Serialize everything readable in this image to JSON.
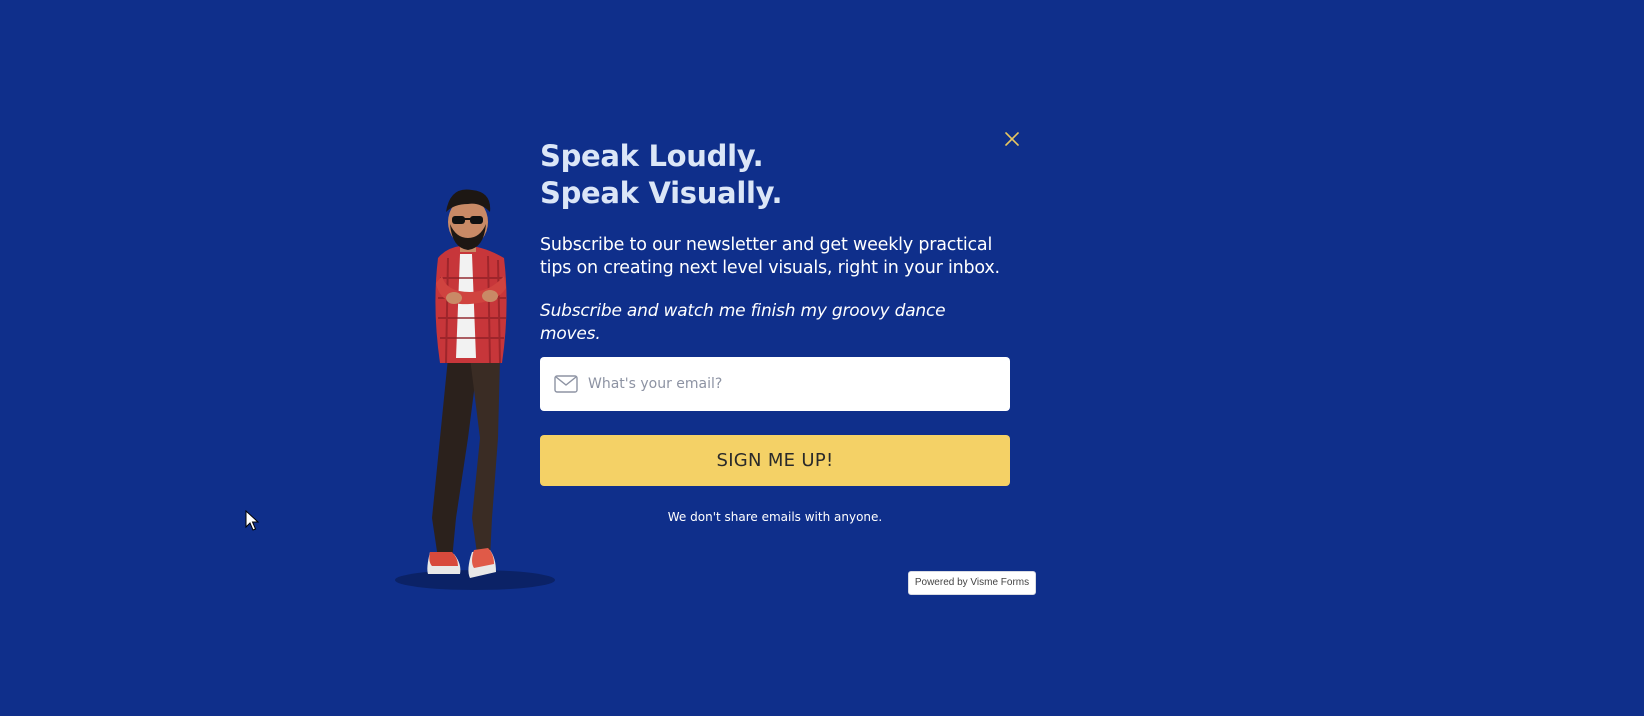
{
  "popup": {
    "headline_line1": "Speak Loudly.",
    "headline_line2": "Speak Visually.",
    "subtitle": "Subscribe to our newsletter and get weekly practical tips on creating next level visuals, right in your inbox.",
    "italic_note": "Subscribe and watch me finish my groovy dance moves.",
    "email_placeholder": "What's your email?",
    "signup_label": "SIGN ME UP!",
    "privacy_note": "We don't share emails with anyone.",
    "powered_by": "Powered by Visme Forms"
  },
  "icons": {
    "close": "close-icon",
    "email": "envelope-icon",
    "cursor": "mouse-cursor-icon"
  },
  "colors": {
    "background": "#0f2f8b",
    "headline": "#dbe6f7",
    "button": "#f4d166",
    "close_icon": "#e8c760"
  }
}
